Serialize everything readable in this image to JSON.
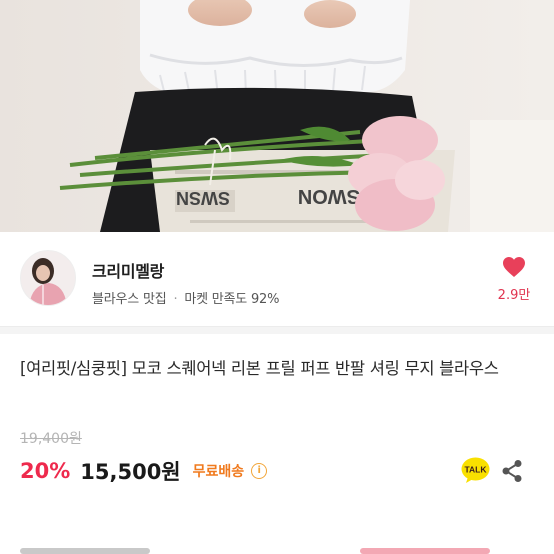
{
  "seller": {
    "name": "크리미멜랑",
    "category": "블라우스 맛집",
    "separator": "·",
    "satisfaction": "마켓 만족도 92%",
    "like_count": "2.9만"
  },
  "product": {
    "title": "[여리핏/심쿵핏] 모코 스퀘어넥 리본 프릴 퍼프 반팔 셔링 무지 블라우스",
    "original_price": "19,400원",
    "discount": "20%",
    "price": "15,500원",
    "shipping": "무료배송",
    "info_glyph": "i"
  },
  "icons": {
    "like": "heart-icon",
    "talk": "kakao-talk-icon",
    "share": "share-icon",
    "info": "info-icon"
  },
  "colors": {
    "accent_red": "#ee2a4d",
    "heart": "#e8405a",
    "shipping_orange": "#f07a1e",
    "talk_yellow": "#f9e000"
  }
}
